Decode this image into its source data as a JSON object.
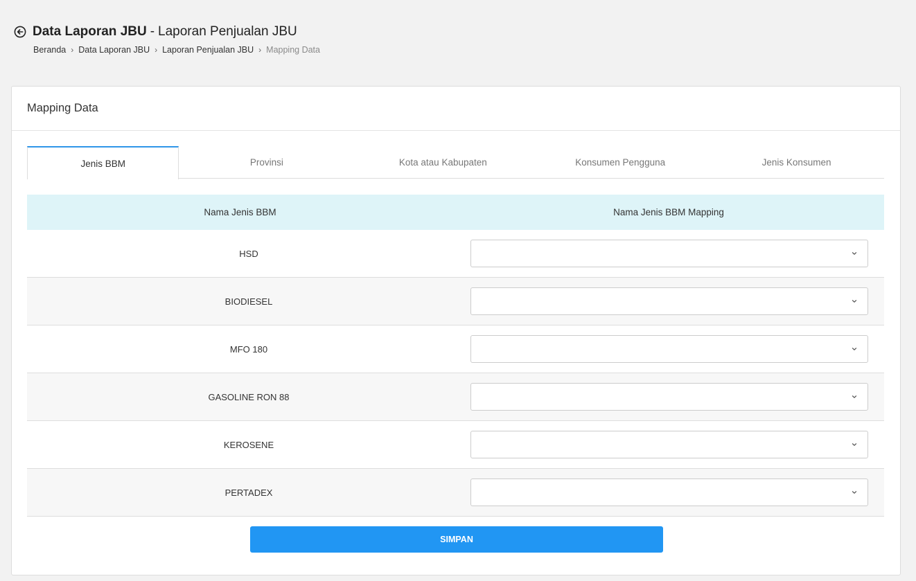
{
  "header": {
    "title_bold": "Data Laporan JBU",
    "title_separator": "-",
    "title_sub": "Laporan Penjualan JBU",
    "back_icon": "arrow-left-circle-icon"
  },
  "breadcrumb": {
    "items": [
      "Beranda",
      "Data Laporan JBU",
      "Laporan Penjualan JBU",
      "Mapping Data"
    ],
    "separator": "›"
  },
  "card": {
    "title": "Mapping Data"
  },
  "tabs": [
    {
      "label": "Jenis BBM",
      "active": true
    },
    {
      "label": "Provinsi",
      "active": false
    },
    {
      "label": "Kota atau Kabupaten",
      "active": false
    },
    {
      "label": "Konsumen Pengguna",
      "active": false
    },
    {
      "label": "Jenis Konsumen",
      "active": false
    }
  ],
  "table": {
    "columns": [
      "Nama Jenis BBM",
      "Nama Jenis BBM Mapping"
    ],
    "rows": [
      {
        "name": "HSD",
        "mapping": ""
      },
      {
        "name": "BIODIESEL",
        "mapping": ""
      },
      {
        "name": "MFO 180",
        "mapping": ""
      },
      {
        "name": "GASOLINE RON 88",
        "mapping": ""
      },
      {
        "name": "KEROSENE",
        "mapping": ""
      },
      {
        "name": "PERTADEX",
        "mapping": ""
      }
    ]
  },
  "actions": {
    "save_label": "SIMPAN"
  },
  "colors": {
    "accent": "#2196f3",
    "active_tab_border": "#2e95e8",
    "table_header_bg": "#def4f8",
    "page_bg": "#f2f2f2"
  }
}
